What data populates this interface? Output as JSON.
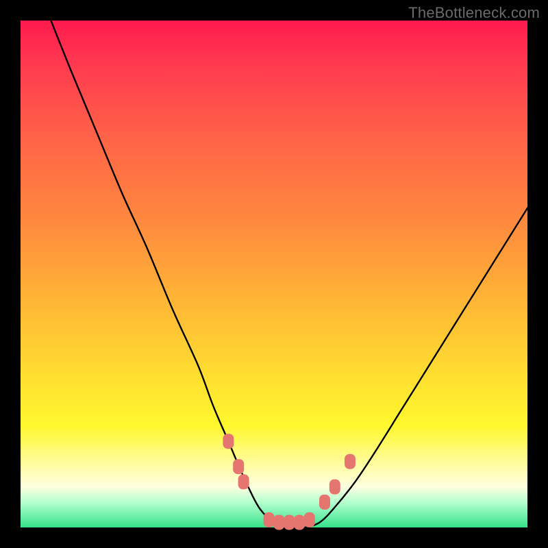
{
  "watermark": {
    "text": "TheBottleneck.com"
  },
  "colors": {
    "frame": "#000000",
    "curve": "#000000",
    "marker": "#e5766f",
    "gradient_stops": [
      "#ff1a4d",
      "#ff3850",
      "#ff6048",
      "#ff8a3e",
      "#ffb536",
      "#ffde30",
      "#fff82e",
      "#fffca8",
      "#fdffe0",
      "#b5ffcf",
      "#35e38a"
    ]
  },
  "chart_data": {
    "type": "line",
    "title": "",
    "xlabel": "",
    "ylabel": "",
    "xlim": [
      0,
      100
    ],
    "ylim": [
      0,
      100
    ],
    "note": "y is bottleneck %, 0 at bottom (green), 100 at top (red). x is a normalized 0-100 axis. Values estimated from pixel positions; the curve is a V with flat bottom near x≈47-58.",
    "series": [
      {
        "name": "bottleneck-curve",
        "x": [
          6,
          10,
          15,
          20,
          25,
          30,
          35,
          38,
          41,
          44,
          47,
          50,
          53,
          56,
          59,
          62,
          66,
          70,
          75,
          80,
          85,
          90,
          95,
          100
        ],
        "y": [
          100,
          90,
          78,
          66,
          55,
          43,
          32,
          24,
          17,
          10,
          4,
          1,
          0,
          0,
          1,
          4,
          9,
          15,
          23,
          31,
          39,
          47,
          55,
          63
        ]
      }
    ],
    "markers": {
      "name": "highlighted-points",
      "note": "rounded salmon markers near the valley, estimated",
      "points": [
        {
          "x": 41,
          "y": 17
        },
        {
          "x": 43,
          "y": 12
        },
        {
          "x": 44,
          "y": 9
        },
        {
          "x": 49,
          "y": 1.5
        },
        {
          "x": 51,
          "y": 1
        },
        {
          "x": 53,
          "y": 1
        },
        {
          "x": 55,
          "y": 1
        },
        {
          "x": 57,
          "y": 1.5
        },
        {
          "x": 60,
          "y": 5
        },
        {
          "x": 62,
          "y": 8
        },
        {
          "x": 65,
          "y": 13
        }
      ]
    }
  }
}
